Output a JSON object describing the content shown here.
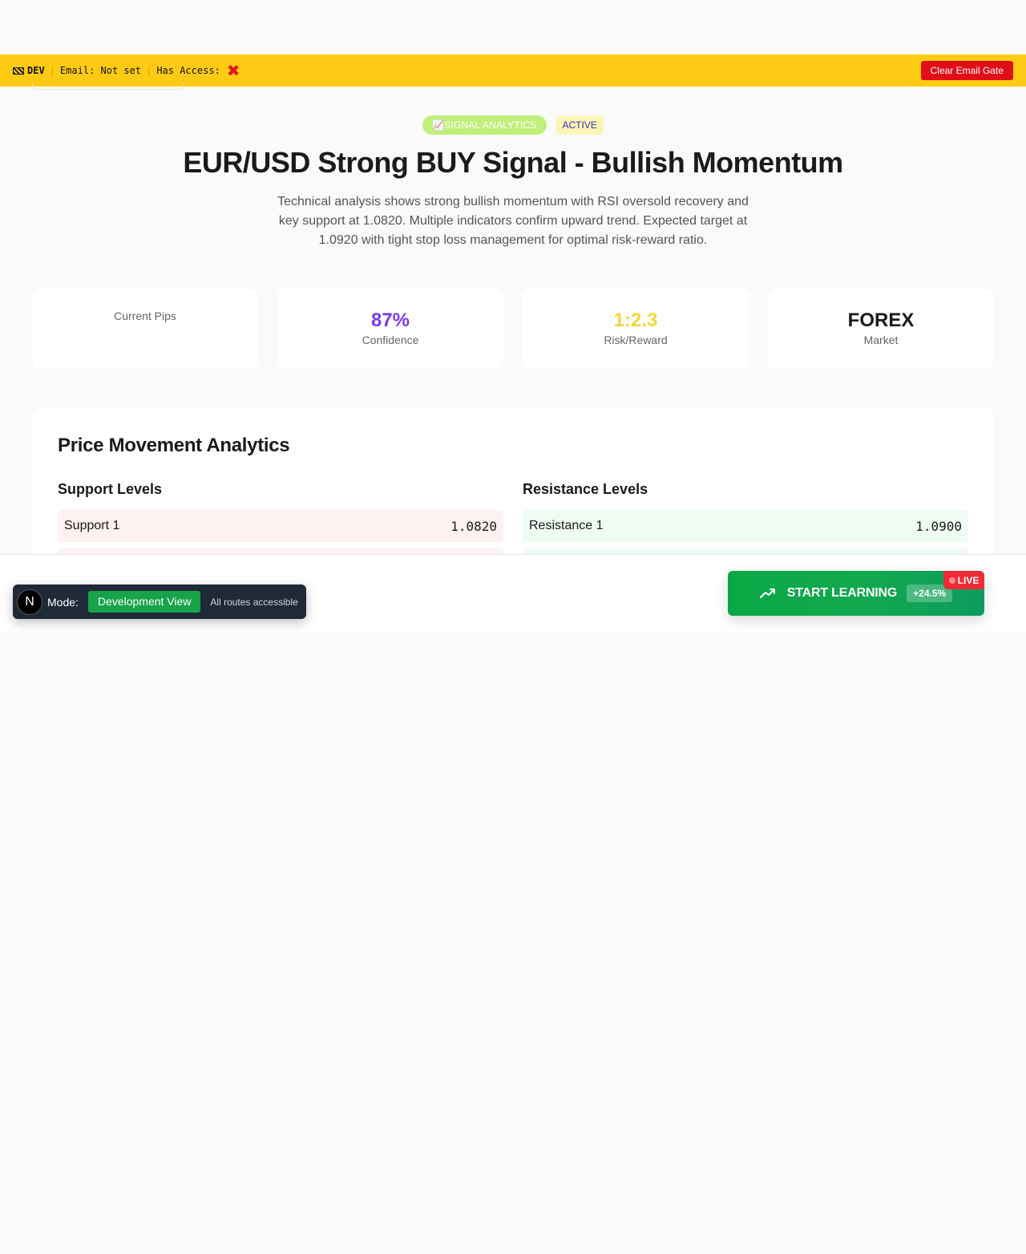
{
  "devbar": {
    "dev_label": "DEV",
    "email_text": "Email: Not set",
    "access_text": "Has Access:",
    "access_mark": "✖",
    "clear_button": "Clear Email Gate"
  },
  "header": {
    "badge_signal": "📈SIGNAL ANALYTICS",
    "badge_status": "ACTIVE",
    "title": "EUR/USD Strong BUY Signal - Bullish Momentum",
    "description": "Technical analysis shows strong bullish momentum with RSI oversold recovery and key support at 1.0820. Multiple indicators confirm upward trend. Expected target at 1.0920 with tight stop loss management for optimal risk-reward ratio."
  },
  "stats": [
    {
      "value": "",
      "label": "Current Pips"
    },
    {
      "value": "87%",
      "label": "Confidence",
      "color": "#7c3aed"
    },
    {
      "value": "1:2.3",
      "label": "Risk/Reward",
      "color": "#f5d63d"
    },
    {
      "value": "FOREX",
      "label": "Market",
      "color": "#1a1a1a"
    }
  ],
  "analytics": {
    "title": "Price Movement Analytics",
    "support_title": "Support Levels",
    "resistance_title": "Resistance Levels",
    "support": [
      {
        "label": "Support 1",
        "value": "1.0820"
      }
    ],
    "resistance": [
      {
        "label": "Resistance 1",
        "value": "1.0900"
      }
    ]
  },
  "mode_bar": {
    "logo": "N",
    "label": "Mode:",
    "mode": "Development View",
    "note": "All routes accessible"
  },
  "cta": {
    "icon": "trending-up-icon",
    "label": "START LEARNING",
    "percent": "+24.5%",
    "live": "LIVE"
  }
}
